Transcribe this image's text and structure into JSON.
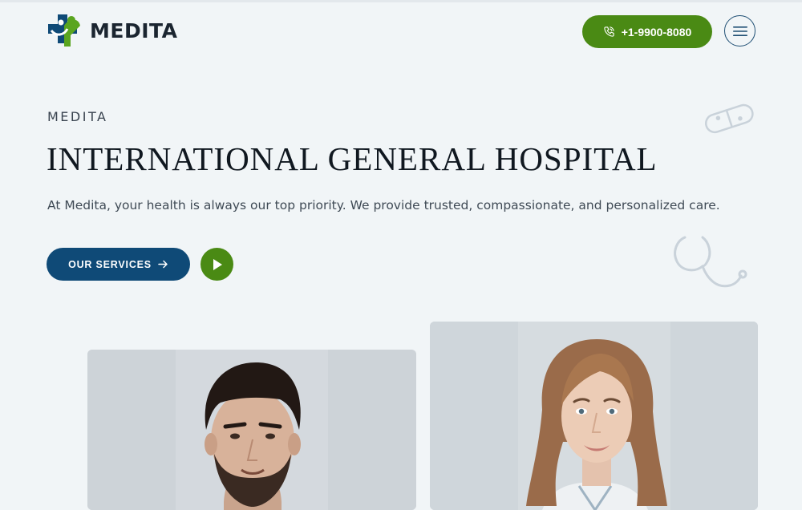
{
  "header": {
    "brand": "MEDITA",
    "phone_label": "+1-9900-8080"
  },
  "hero": {
    "eyebrow": "MEDITA",
    "title": "INTERNATIONAL GENERAL HOSPITAL",
    "description": "At Medita, your health is always our top priority. We provide trusted, compassionate, and personalized care.",
    "services_label": "OUR SERVICES"
  },
  "icons": {
    "logo": "medical-cross-person-logo",
    "phone": "phone-icon",
    "menu": "hamburger-menu-icon",
    "arrow": "arrow-right-icon",
    "play": "play-icon",
    "decor_1": "pill-icon",
    "decor_2": "stethoscope-icon"
  },
  "colors": {
    "background": "#f1f5f7",
    "brand_blue": "#0f4a77",
    "brand_green": "#4a8a14",
    "text_dark": "#101820"
  }
}
